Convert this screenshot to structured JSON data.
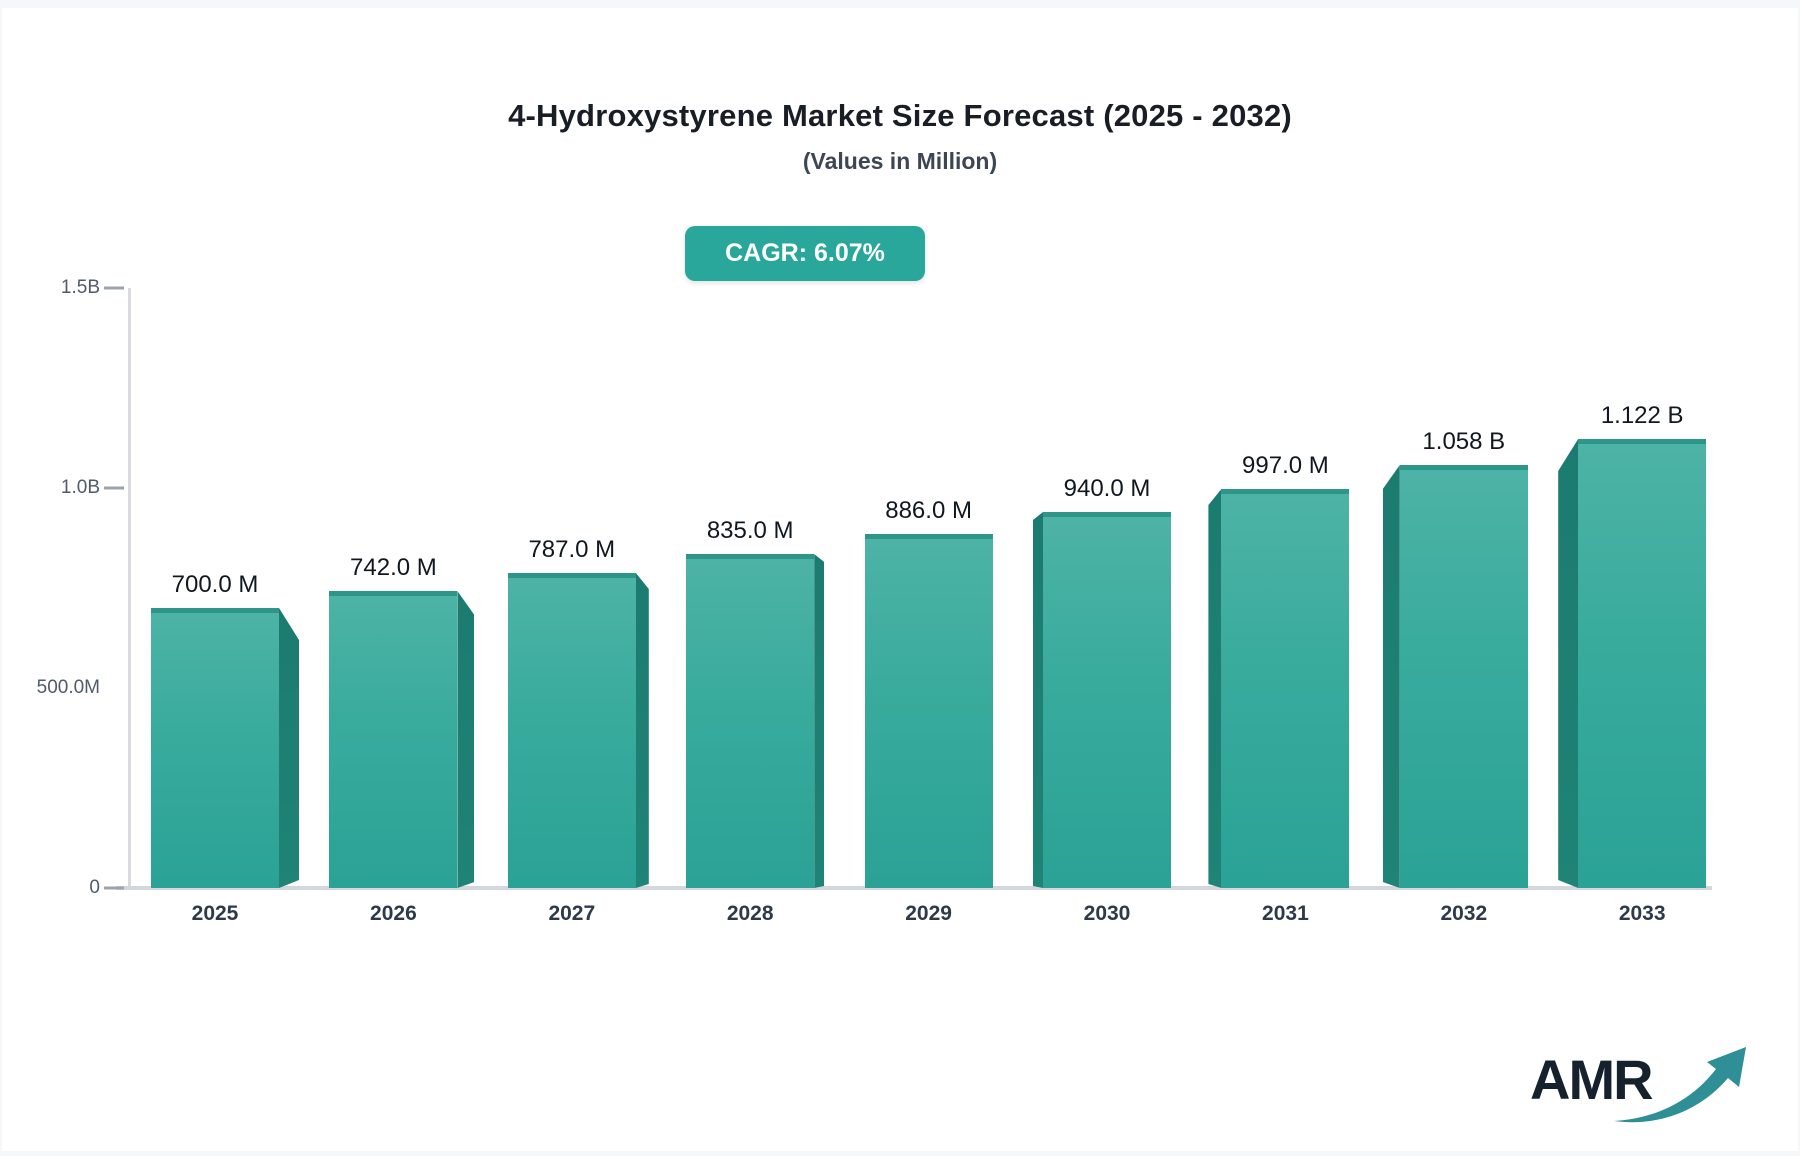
{
  "page": {
    "background": "#f6f7f9",
    "card_background": "#ffffff"
  },
  "header": {
    "title": "4-Hydroxystyrene Market Size Forecast (2025 - 2032)",
    "subtitle": "(Values in Million)"
  },
  "badge": {
    "label": "CAGR: 6.07%",
    "background": "#2aa79b",
    "text_color": "#ffffff"
  },
  "chart_data": {
    "type": "bar",
    "title": "4-Hydroxystyrene Market Size Forecast (2025 - 2032)",
    "subtitle": "(Values in Million)",
    "categories": [
      "2025",
      "2026",
      "2027",
      "2028",
      "2029",
      "2030",
      "2031",
      "2032",
      "2033"
    ],
    "values_million": [
      700,
      742,
      787,
      835,
      886,
      940,
      997,
      1058,
      1122
    ],
    "bar_labels": [
      "700.0 M",
      "742.0 M",
      "787.0 M",
      "835.0 M",
      "886.0 M",
      "940.0 M",
      "997.0 M",
      "1.058 B",
      "1.122 B"
    ],
    "y_ticks": [
      {
        "label": "1.5B",
        "value_million": 1500
      },
      {
        "label": "1.0B",
        "value_million": 1000
      },
      {
        "label": "500.0M",
        "value_million": 500
      },
      {
        "label": "0",
        "value_million": 0
      }
    ],
    "ylim_million": [
      0,
      1500
    ],
    "xlabel": "",
    "ylabel": "",
    "grid": false,
    "legend": false,
    "bar_color": "#35a99b",
    "bar_side_color": "#1c7b70",
    "axis_color": "#d9dbe0"
  },
  "logo": {
    "text": "AMR",
    "text_color": "#15222e",
    "arrow_color": "#2e8f96"
  }
}
